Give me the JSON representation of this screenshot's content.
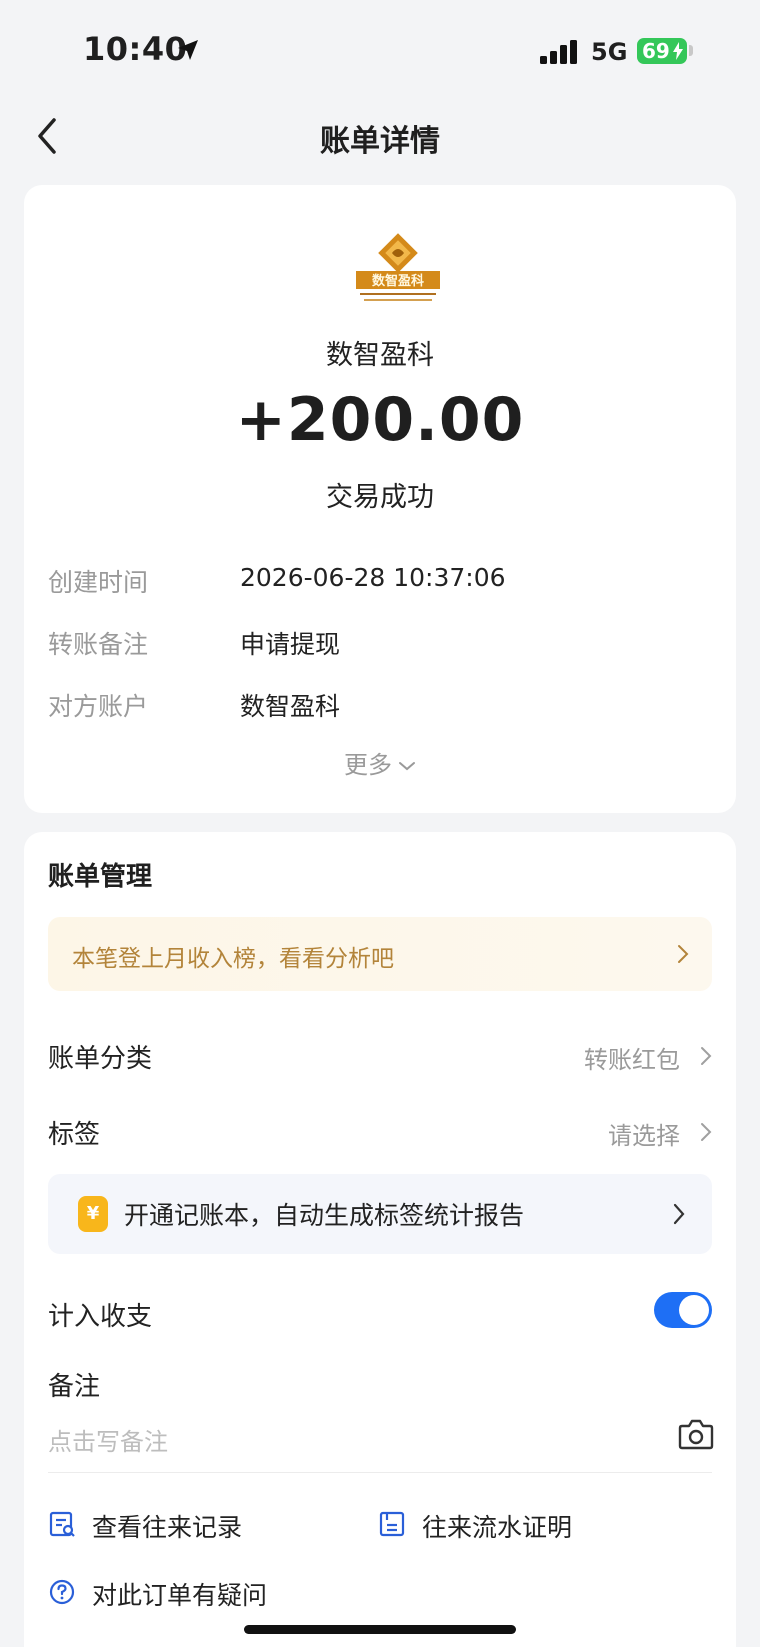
{
  "status_bar": {
    "time": "10:40",
    "network": "5G",
    "battery": "69"
  },
  "nav": {
    "title": "账单详情"
  },
  "summary": {
    "merchant_name": "数智盈科",
    "amount": "+200.00",
    "status": "交易成功",
    "logo_text": "数智盈科"
  },
  "details": [
    {
      "label": "创建时间",
      "value": "2026-06-28 10:37:06"
    },
    {
      "label": "转账备注",
      "value": "申请提现"
    },
    {
      "label": "对方账户",
      "value": "数智盈科"
    }
  ],
  "more_label": "更多",
  "management": {
    "title": "账单管理",
    "promo_text": "本笔登上月收入榜，看看分析吧",
    "category_label": "账单分类",
    "category_value": "转账红包",
    "tag_label": "标签",
    "tag_value": "请选择",
    "ledger_icon": "¥",
    "ledger_text": "开通记账本，自动生成标签统计报告",
    "count_label": "计入收支",
    "count_enabled": true,
    "note_label": "备注",
    "note_placeholder": "点击写备注"
  },
  "links": {
    "history": "查看往来记录",
    "statement": "往来流水证明",
    "question": "对此订单有疑问"
  },
  "colors": {
    "accent": "#1e6ff5",
    "promo_text": "#b3843a",
    "battery": "#34c759"
  }
}
